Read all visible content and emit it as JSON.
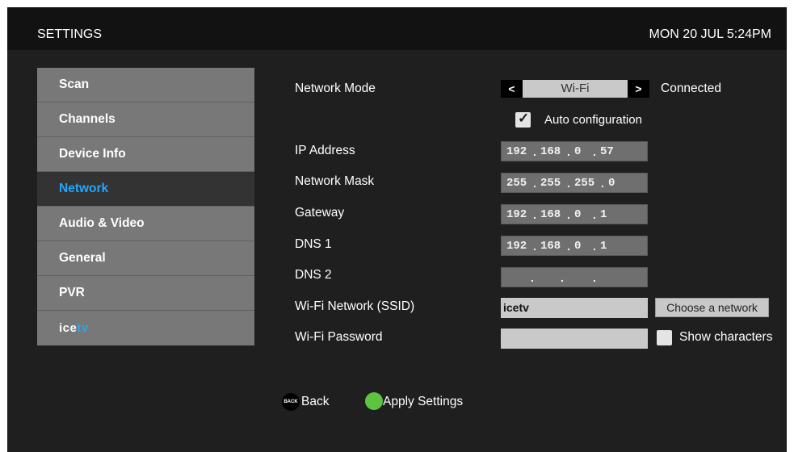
{
  "header": {
    "title": "SETTINGS",
    "clock": "MON 20 JUL 5:24PM"
  },
  "sidebar": {
    "items": [
      {
        "label": "Scan"
      },
      {
        "label": "Channels"
      },
      {
        "label": "Device Info"
      },
      {
        "label": "Network",
        "active": true
      },
      {
        "label": "Audio & Video"
      },
      {
        "label": "General"
      },
      {
        "label": "PVR"
      }
    ],
    "logo": {
      "part1": "ice",
      "part2": "tv"
    }
  },
  "network": {
    "mode_label": "Network Mode",
    "mode_value": "Wi-Fi",
    "prev_arrow": "<",
    "next_arrow": ">",
    "status": "Connected",
    "auto_config_label": "Auto configuration",
    "auto_config_checked": true,
    "ip_label": "IP Address",
    "ip": [
      "192",
      "168",
      "0",
      "57"
    ],
    "mask_label": "Network Mask",
    "mask": [
      "255",
      "255",
      "255",
      "0"
    ],
    "gateway_label": "Gateway",
    "gateway": [
      "192",
      "168",
      "0",
      "1"
    ],
    "dns1_label": "DNS 1",
    "dns1": [
      "192",
      "168",
      "0",
      "1"
    ],
    "dns2_label": "DNS 2",
    "dns2": [
      "",
      "",
      "",
      ""
    ],
    "ssid_label": "Wi-Fi Network (SSID)",
    "ssid_value": "icetv",
    "choose_network_label": "Choose a network",
    "password_label": "Wi-Fi Password",
    "password_value": "",
    "show_characters_label": "Show characters",
    "show_characters_checked": false
  },
  "footer": {
    "back_badge": "BACK",
    "back_label": "Back",
    "apply_label": "Apply Settings"
  },
  "colors": {
    "active_item": "#1fa7ff",
    "apply_dot": "#5cc43f"
  }
}
